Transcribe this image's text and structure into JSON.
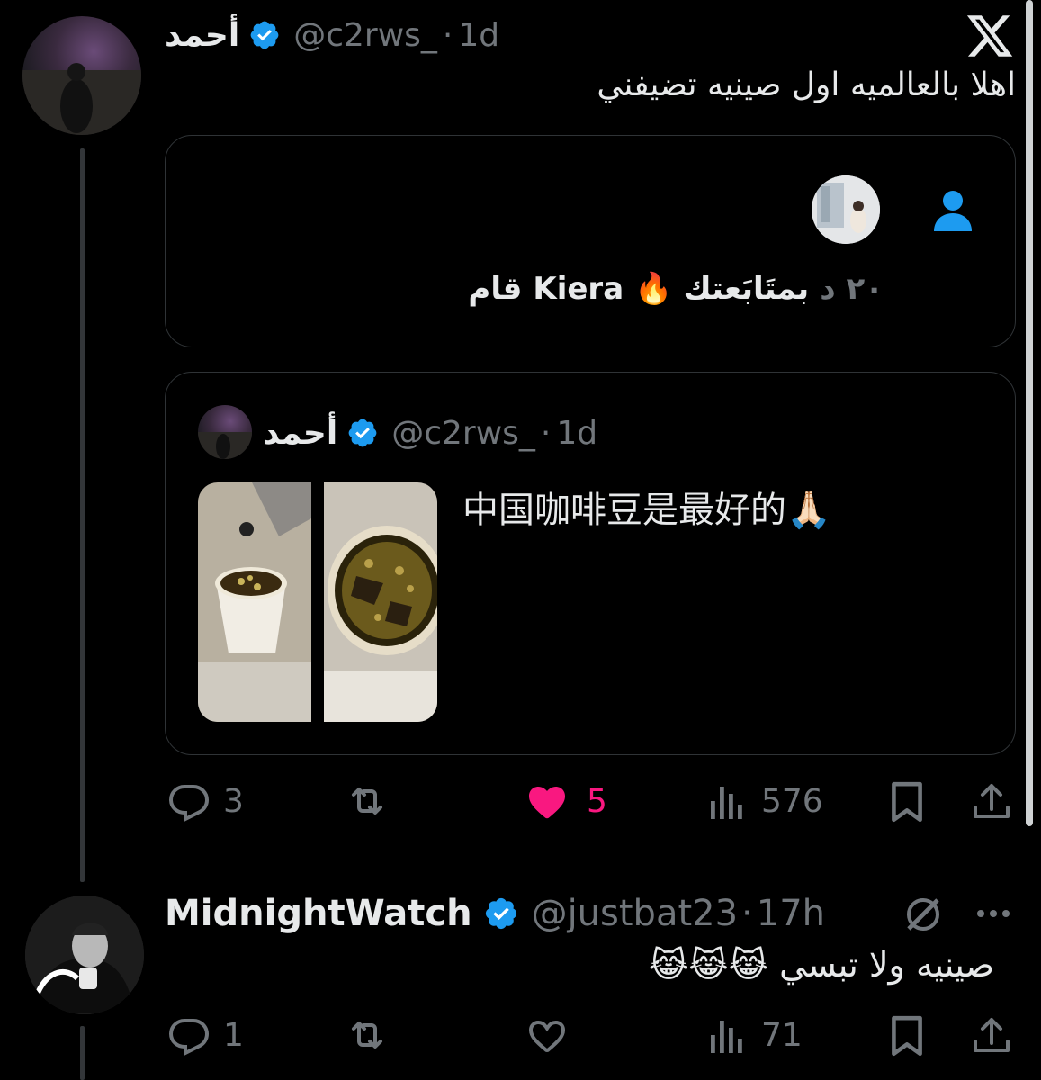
{
  "main_post": {
    "author_name": "أحمد",
    "handle": "@c2rws_",
    "separator": "·",
    "time": "1d",
    "text": "اهلا بالعالميه اول صينيه تضيفني",
    "notification_card": {
      "name": "Kiera",
      "text_before_name": "قام",
      "emoji": "🔥",
      "text_after_emoji": "بمتَابَعتك",
      "time": "٢٠ د"
    },
    "quoted": {
      "author_name": "أحمد",
      "handle": "@c2rws_",
      "separator": "·",
      "time": "1d",
      "text": "中国咖啡豆是最好的🙏🏻"
    },
    "actions": {
      "replies": "3",
      "reposts": "",
      "likes": "5",
      "views": "576"
    }
  },
  "reply_post": {
    "author_name": "MidnightWatch",
    "handle": "@justbat23",
    "separator": "·",
    "time": "17h",
    "text": "صينيه ولا تبسي 😹😹😹",
    "actions": {
      "replies": "1",
      "reposts": "",
      "likes": "",
      "views": "71"
    }
  },
  "colors": {
    "background": "#000000",
    "text": "#e7e9ea",
    "muted": "#71767b",
    "verified": "#1d9bf0",
    "like": "#f91880",
    "border": "#2f3336"
  },
  "icons": [
    "x-logo-icon",
    "verified-badge-icon",
    "person-icon",
    "reply-icon",
    "repost-icon",
    "heart-icon",
    "views-icon",
    "bookmark-icon",
    "share-icon",
    "grok-icon",
    "more-icon"
  ]
}
